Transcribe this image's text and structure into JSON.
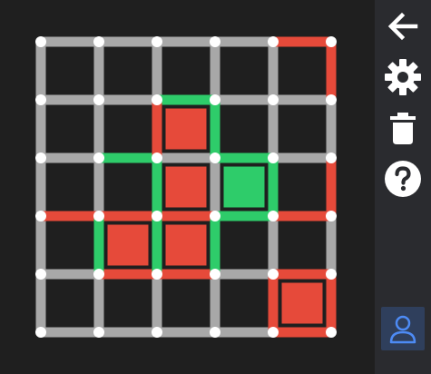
{
  "colors": {
    "background": "#1f1f1f",
    "sidebar": "#2a2b2f",
    "edge_default": "#a8a8a8",
    "edge_red": "#e64a3a",
    "edge_green": "#2ecc6a",
    "cell_red": "#e64a3a",
    "cell_green": "#2ecc6a",
    "node": "#ffffff",
    "icon": "#ffffff",
    "profile_bg": "#2f3f5c",
    "profile_icon": "#4d8bf5"
  },
  "grid": {
    "rows": 5,
    "cols": 5,
    "cells": [
      {
        "row": 1,
        "col": 2,
        "color": "red"
      },
      {
        "row": 2,
        "col": 2,
        "color": "red"
      },
      {
        "row": 2,
        "col": 3,
        "color": "green"
      },
      {
        "row": 3,
        "col": 1,
        "color": "red"
      },
      {
        "row": 3,
        "col": 2,
        "color": "red"
      },
      {
        "row": 4,
        "col": 4,
        "color": "red"
      }
    ],
    "edges": [
      {
        "type": "h",
        "row": 0,
        "col": 4,
        "color": "red"
      },
      {
        "type": "v",
        "row": 0,
        "col": 5,
        "color": "red"
      },
      {
        "type": "h",
        "row": 1,
        "col": 2,
        "color": "green"
      },
      {
        "type": "v",
        "row": 1,
        "col": 2,
        "color": "red"
      },
      {
        "type": "v",
        "row": 1,
        "col": 3,
        "color": "green"
      },
      {
        "type": "h",
        "row": 2,
        "col": 1,
        "color": "green"
      },
      {
        "type": "h",
        "row": 2,
        "col": 3,
        "color": "green"
      },
      {
        "type": "v",
        "row": 2,
        "col": 2,
        "color": "green"
      },
      {
        "type": "v",
        "row": 2,
        "col": 4,
        "color": "green"
      },
      {
        "type": "v",
        "row": 2,
        "col": 5,
        "color": "red"
      },
      {
        "type": "h",
        "row": 3,
        "col": 0,
        "color": "red"
      },
      {
        "type": "h",
        "row": 3,
        "col": 1,
        "color": "red"
      },
      {
        "type": "h",
        "row": 3,
        "col": 2,
        "color": "red"
      },
      {
        "type": "h",
        "row": 3,
        "col": 3,
        "color": "green"
      },
      {
        "type": "h",
        "row": 3,
        "col": 4,
        "color": "red"
      },
      {
        "type": "v",
        "row": 3,
        "col": 1,
        "color": "green"
      },
      {
        "type": "v",
        "row": 3,
        "col": 2,
        "color": "green"
      },
      {
        "type": "v",
        "row": 3,
        "col": 3,
        "color": "green"
      },
      {
        "type": "h",
        "row": 4,
        "col": 1,
        "color": "red"
      },
      {
        "type": "h",
        "row": 4,
        "col": 2,
        "color": "red"
      },
      {
        "type": "h",
        "row": 4,
        "col": 4,
        "color": "red"
      },
      {
        "type": "v",
        "row": 4,
        "col": 4,
        "color": "red"
      },
      {
        "type": "v",
        "row": 4,
        "col": 5,
        "color": "red"
      },
      {
        "type": "h",
        "row": 5,
        "col": 4,
        "color": "red"
      }
    ]
  },
  "sidebar": {
    "buttons": [
      {
        "name": "back-button",
        "icon": "arrow-left-icon"
      },
      {
        "name": "settings-button",
        "icon": "gear-icon"
      },
      {
        "name": "delete-button",
        "icon": "trash-icon"
      },
      {
        "name": "help-button",
        "icon": "question-icon"
      },
      {
        "name": "profile-button",
        "icon": "user-icon"
      }
    ]
  }
}
